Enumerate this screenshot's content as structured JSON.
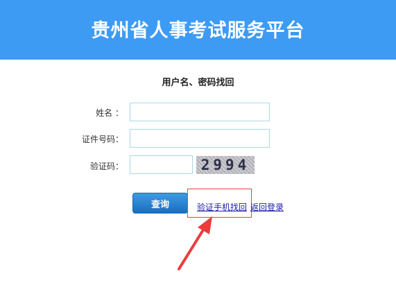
{
  "header": {
    "title": "贵州省人事考试服务平台"
  },
  "form": {
    "title": "用户名、密码找回",
    "name_label": "姓名 ：",
    "name_value": "",
    "id_label": "证件号码：",
    "id_value": "",
    "captcha_label": "验证码：",
    "captcha_value": "",
    "captcha_image_text": "2994"
  },
  "actions": {
    "query_label": "查询",
    "verify_phone_link": "验证手机找回",
    "back_login_link": "返回登录"
  },
  "colors": {
    "header_bg": "#3d9bf3",
    "annotation_red": "#e14242"
  },
  "icons": {
    "annotation": "red-arrow-icon"
  }
}
